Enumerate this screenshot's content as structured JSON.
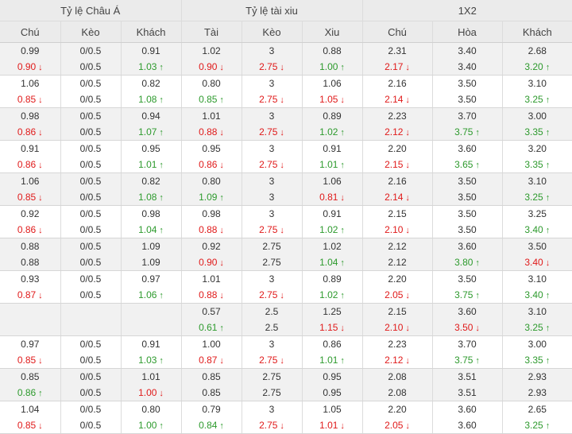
{
  "groups": [
    "Tỷ lệ Châu Á",
    "Tỷ lệ tài xiu",
    "1X2"
  ],
  "columns": [
    "Chú",
    "Kèo",
    "Khách",
    "Tài",
    "Kèo",
    "Xiu",
    "Chú",
    "Hòa",
    "Khách"
  ],
  "rows": [
    [
      [
        "0.99",
        "0.90",
        "down"
      ],
      [
        "0/0.5",
        "0/0.5",
        ""
      ],
      [
        "0.91",
        "1.03",
        "up"
      ],
      [
        "1.02",
        "0.90",
        "down"
      ],
      [
        "3",
        "2.75",
        "down"
      ],
      [
        "0.88",
        "1.00",
        "up"
      ],
      [
        "2.31",
        "2.17",
        "down"
      ],
      [
        "3.40",
        "3.40",
        ""
      ],
      [
        "2.68",
        "3.20",
        "up"
      ]
    ],
    [
      [
        "1.06",
        "0.85",
        "down"
      ],
      [
        "0/0.5",
        "0/0.5",
        ""
      ],
      [
        "0.82",
        "1.08",
        "up"
      ],
      [
        "0.80",
        "0.85",
        "up"
      ],
      [
        "3",
        "2.75",
        "down"
      ],
      [
        "1.06",
        "1.05",
        "down"
      ],
      [
        "2.16",
        "2.14",
        "down"
      ],
      [
        "3.50",
        "3.50",
        ""
      ],
      [
        "3.10",
        "3.25",
        "up"
      ]
    ],
    [
      [
        "0.98",
        "0.86",
        "down"
      ],
      [
        "0/0.5",
        "0/0.5",
        ""
      ],
      [
        "0.94",
        "1.07",
        "up"
      ],
      [
        "1.01",
        "0.88",
        "down"
      ],
      [
        "3",
        "2.75",
        "down"
      ],
      [
        "0.89",
        "1.02",
        "up"
      ],
      [
        "2.23",
        "2.12",
        "down"
      ],
      [
        "3.70",
        "3.75",
        "up"
      ],
      [
        "3.00",
        "3.35",
        "up"
      ]
    ],
    [
      [
        "0.91",
        "0.86",
        "down"
      ],
      [
        "0/0.5",
        "0/0.5",
        ""
      ],
      [
        "0.95",
        "1.01",
        "up"
      ],
      [
        "0.95",
        "0.86",
        "down"
      ],
      [
        "3",
        "2.75",
        "down"
      ],
      [
        "0.91",
        "1.01",
        "up"
      ],
      [
        "2.20",
        "2.15",
        "down"
      ],
      [
        "3.60",
        "3.65",
        "up"
      ],
      [
        "3.20",
        "3.35",
        "up"
      ]
    ],
    [
      [
        "1.06",
        "0.85",
        "down"
      ],
      [
        "0/0.5",
        "0/0.5",
        ""
      ],
      [
        "0.82",
        "1.08",
        "up"
      ],
      [
        "0.80",
        "1.09",
        "up"
      ],
      [
        "3",
        "3",
        ""
      ],
      [
        "1.06",
        "0.81",
        "down"
      ],
      [
        "2.16",
        "2.14",
        "down"
      ],
      [
        "3.50",
        "3.50",
        ""
      ],
      [
        "3.10",
        "3.25",
        "up"
      ]
    ],
    [
      [
        "0.92",
        "0.86",
        "down"
      ],
      [
        "0/0.5",
        "0/0.5",
        ""
      ],
      [
        "0.98",
        "1.04",
        "up"
      ],
      [
        "0.98",
        "0.88",
        "down"
      ],
      [
        "3",
        "2.75",
        "down"
      ],
      [
        "0.91",
        "1.02",
        "up"
      ],
      [
        "2.15",
        "2.10",
        "down"
      ],
      [
        "3.50",
        "3.50",
        ""
      ],
      [
        "3.25",
        "3.40",
        "up"
      ]
    ],
    [
      [
        "0.88",
        "0.88",
        ""
      ],
      [
        "0/0.5",
        "0/0.5",
        ""
      ],
      [
        "1.09",
        "1.09",
        ""
      ],
      [
        "0.92",
        "0.90",
        "down"
      ],
      [
        "2.75",
        "2.75",
        ""
      ],
      [
        "1.02",
        "1.04",
        "up"
      ],
      [
        "2.12",
        "2.12",
        ""
      ],
      [
        "3.60",
        "3.80",
        "up"
      ],
      [
        "3.50",
        "3.40",
        "down"
      ]
    ],
    [
      [
        "0.93",
        "0.87",
        "down"
      ],
      [
        "0/0.5",
        "0/0.5",
        ""
      ],
      [
        "0.97",
        "1.06",
        "up"
      ],
      [
        "1.01",
        "0.88",
        "down"
      ],
      [
        "3",
        "2.75",
        "down"
      ],
      [
        "0.89",
        "1.02",
        "up"
      ],
      [
        "2.20",
        "2.05",
        "down"
      ],
      [
        "3.50",
        "3.75",
        "up"
      ],
      [
        "3.10",
        "3.40",
        "up"
      ]
    ],
    [
      [
        "",
        "",
        ""
      ],
      [
        "",
        "",
        ""
      ],
      [
        "",
        "",
        ""
      ],
      [
        "0.57",
        "0.61",
        "up"
      ],
      [
        "2.5",
        "2.5",
        ""
      ],
      [
        "1.25",
        "1.15",
        "down"
      ],
      [
        "2.15",
        "2.10",
        "down"
      ],
      [
        "3.60",
        "3.50",
        "down"
      ],
      [
        "3.10",
        "3.25",
        "up"
      ]
    ],
    [
      [
        "0.97",
        "0.85",
        "down"
      ],
      [
        "0/0.5",
        "0/0.5",
        ""
      ],
      [
        "0.91",
        "1.03",
        "up"
      ],
      [
        "1.00",
        "0.87",
        "down"
      ],
      [
        "3",
        "2.75",
        "down"
      ],
      [
        "0.86",
        "1.01",
        "up"
      ],
      [
        "2.23",
        "2.12",
        "down"
      ],
      [
        "3.70",
        "3.75",
        "up"
      ],
      [
        "3.00",
        "3.35",
        "up"
      ]
    ],
    [
      [
        "0.85",
        "0.86",
        "up"
      ],
      [
        "0/0.5",
        "0/0.5",
        ""
      ],
      [
        "1.01",
        "1.00",
        "down"
      ],
      [
        "0.85",
        "0.85",
        ""
      ],
      [
        "2.75",
        "2.75",
        ""
      ],
      [
        "0.95",
        "0.95",
        ""
      ],
      [
        "2.08",
        "2.08",
        ""
      ],
      [
        "3.51",
        "3.51",
        ""
      ],
      [
        "2.93",
        "2.93",
        ""
      ]
    ],
    [
      [
        "1.04",
        "0.85",
        "down"
      ],
      [
        "0/0.5",
        "0/0.5",
        ""
      ],
      [
        "0.80",
        "1.00",
        "up"
      ],
      [
        "0.79",
        "0.84",
        "up"
      ],
      [
        "3",
        "2.75",
        "down"
      ],
      [
        "1.05",
        "1.01",
        "down"
      ],
      [
        "2.20",
        "2.05",
        "down"
      ],
      [
        "3.60",
        "3.60",
        ""
      ],
      [
        "2.65",
        "3.25",
        "up"
      ]
    ]
  ],
  "icons": {
    "up": "arrow-up-icon",
    "down": "arrow-down-icon"
  },
  "colors": {
    "up": "#2d9a2d",
    "down": "#e01a1a",
    "header_bg": "#ebebeb",
    "alt_row_bg": "#f1f1f1"
  }
}
